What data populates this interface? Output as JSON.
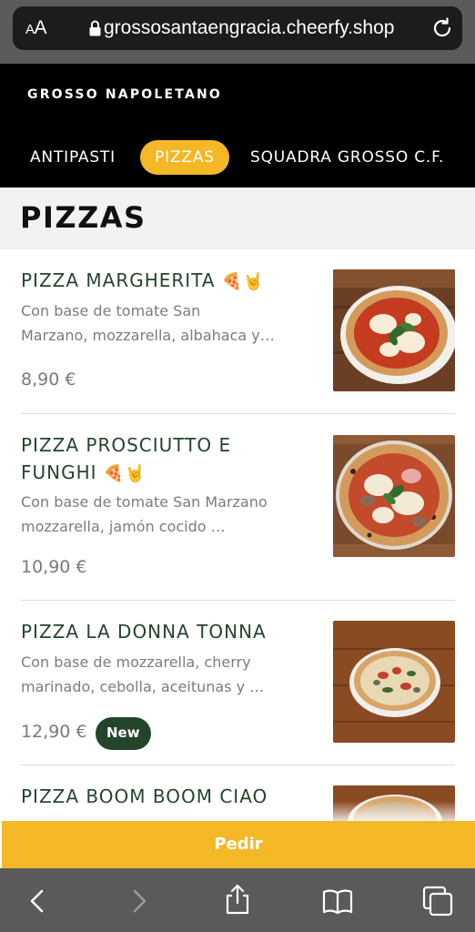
{
  "browser": {
    "text_size_label_small": "A",
    "text_size_label_large": "A",
    "url": "grossosantaengracia.cheerfy.shop",
    "icons": [
      "text-size-icon",
      "lock-icon",
      "reload-icon"
    ]
  },
  "header": {
    "brand": "GROSSO NAPOLETANO",
    "tabs": [
      {
        "label": "ANTIPASTI",
        "active": false
      },
      {
        "label": "PIZZAS",
        "active": true
      },
      {
        "label": "SQUADRA GROSSO C.F.",
        "active": false
      }
    ],
    "active_color": "#f4b826"
  },
  "section": {
    "title": "PIZZAS"
  },
  "products": [
    {
      "name_line1": "PIZZA MARGHERITA",
      "name_line2": "",
      "emojis": "🍕🤘",
      "desc_line1": "Con base de tomate San",
      "desc_line2": "Marzano, mozzarella, albahaca y…",
      "price": "8,90 €",
      "badge": ""
    },
    {
      "name_line1": "PIZZA PROSCIUTTO E",
      "name_line2": "FUNGHI",
      "emojis": "🍕🤘",
      "desc_line1": "Con base de tomate San Marzano",
      "desc_line2": "mozzarella, jamón cocido …",
      "price": "10,90 €",
      "badge": ""
    },
    {
      "name_line1": "PIZZA LA DONNA TONNA",
      "name_line2": "",
      "emojis": "",
      "desc_line1": "Con base de mozzarella, cherry",
      "desc_line2": "marinado, cebolla, aceitunas y …",
      "price": "12,90 €",
      "badge": "New"
    },
    {
      "name_line1": "PIZZA BOOM BOOM CIAO",
      "name_line2": "",
      "emojis": "",
      "desc_line1": "",
      "desc_line2": "",
      "price": "",
      "badge": ""
    }
  ],
  "order_button": {
    "label": "Pedir"
  },
  "toolbar": {
    "icons": [
      "back-icon",
      "forward-icon",
      "share-icon",
      "bookmarks-icon",
      "tabs-icon"
    ]
  },
  "colors": {
    "brand_green": "#24452c",
    "accent_yellow": "#f4b826",
    "header_black": "#000000"
  }
}
